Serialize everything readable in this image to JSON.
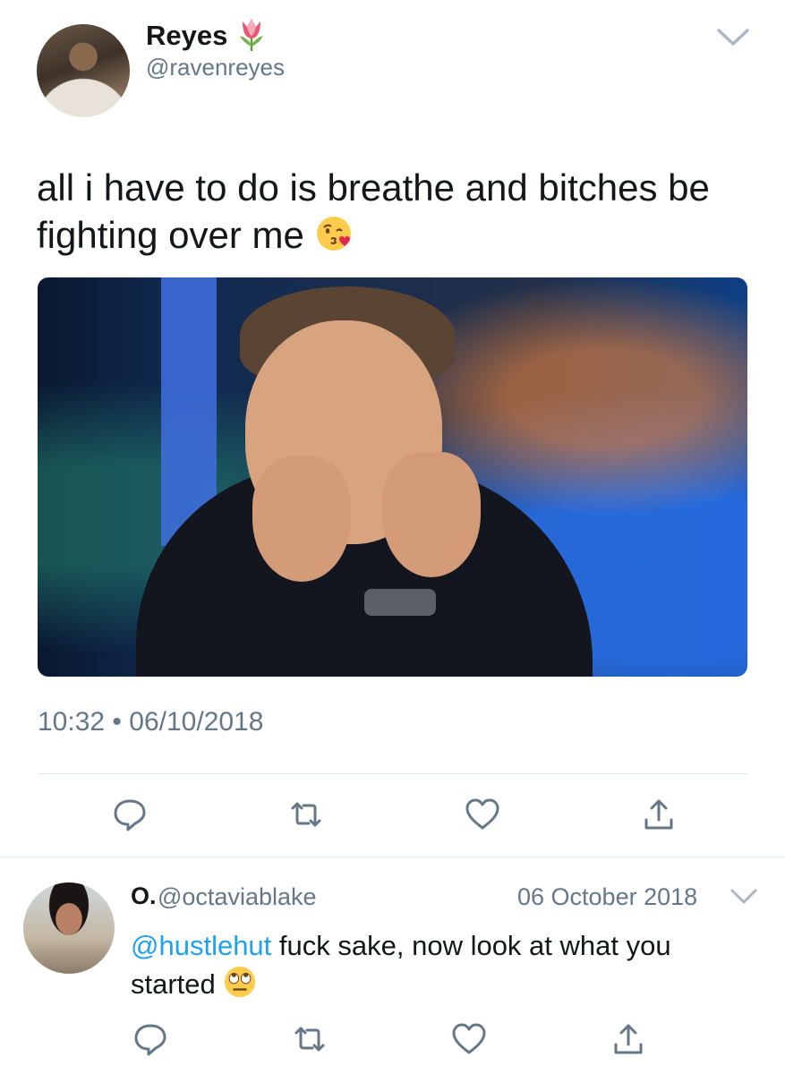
{
  "main_tweet": {
    "display_name": "Reyes",
    "name_emoji": "tulip",
    "handle": "@ravenreyes",
    "text": "all i have to do is breathe and bitches be fighting over me",
    "text_emoji": "face-blowing-a-kiss",
    "time": "10:32",
    "separator": "•",
    "date": "06/10/2018"
  },
  "reply": {
    "display_name": "O.",
    "handle": "@octaviablake",
    "date": "06 October 2018",
    "mention": "@hustlehut",
    "text": " fuck sake, now look at what you started",
    "text_emoji": "face-with-rolling-eyes"
  },
  "actions": [
    "reply-icon",
    "retweet-icon",
    "like-icon",
    "share-icon"
  ],
  "colors": {
    "text": "#14171a",
    "secondary": "#657786",
    "link": "#1da1f2",
    "divider": "#e1e8ed",
    "icon": "#657786"
  }
}
